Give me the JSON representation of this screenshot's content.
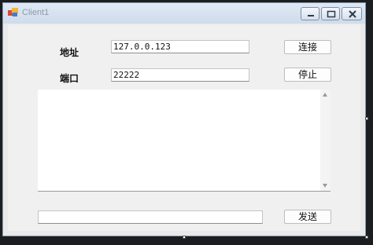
{
  "window": {
    "title": "Client1"
  },
  "form": {
    "address_label": "地址",
    "address_value": "127.0.0.123",
    "port_label": "端口",
    "port_value": "22222",
    "connect_label": "连接",
    "stop_label": "停止",
    "message_value": "",
    "send_label": "发送",
    "log_text": ""
  },
  "icons": {
    "app": "app-icon",
    "minimize": "minimize-icon",
    "maximize": "maximize-icon",
    "close": "close-icon"
  }
}
